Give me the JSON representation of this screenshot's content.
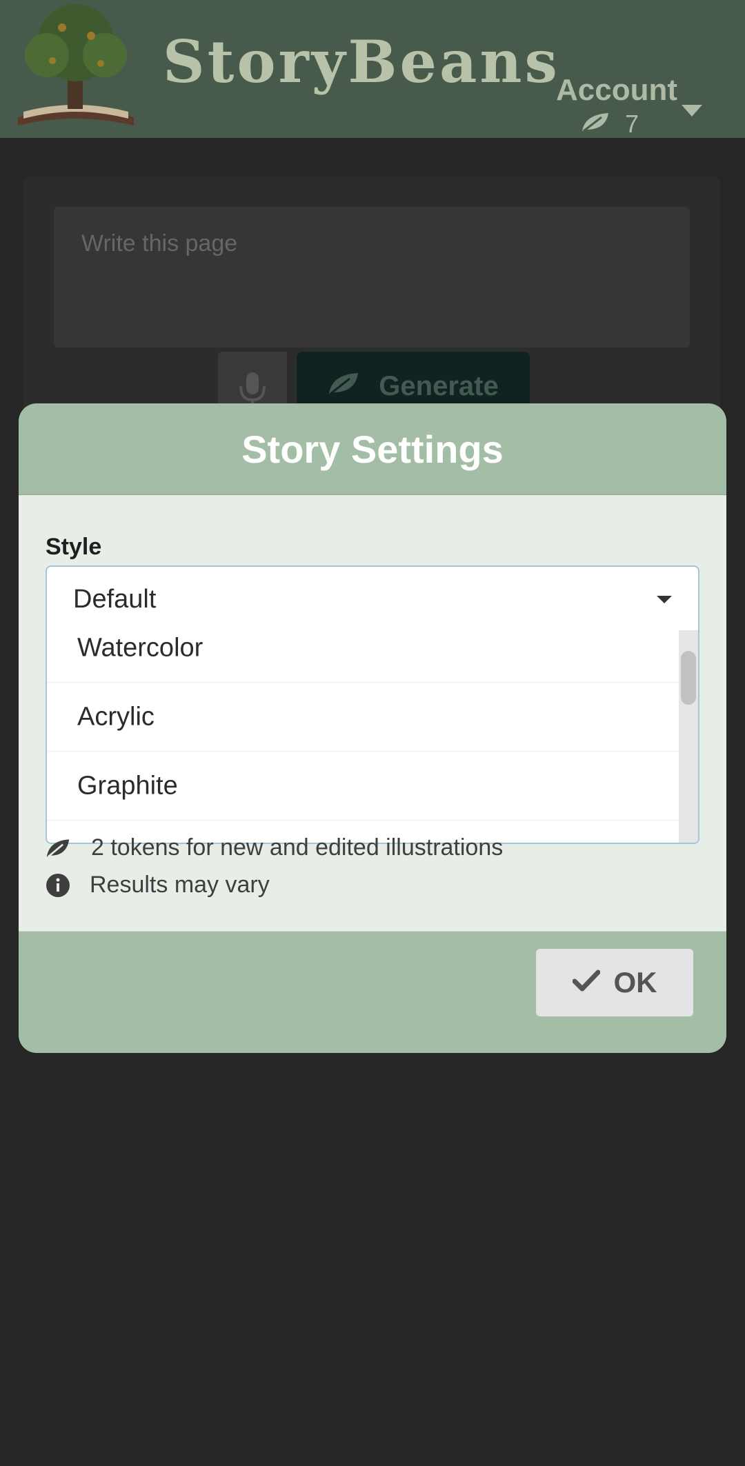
{
  "header": {
    "brand": "StoryBeans",
    "account_label": "Account",
    "token_count": "7"
  },
  "editor": {
    "placeholder": "Write this page",
    "generate_label": "Generate"
  },
  "modal": {
    "title": "Story Settings",
    "style_label": "Style",
    "selected_style": "Default",
    "options": [
      "Watercolor",
      "Acrylic",
      "Graphite"
    ],
    "info": [
      {
        "icon": "leaf-icon",
        "text": "2 tokens for new and edited illustrations"
      },
      {
        "icon": "info-circle-icon",
        "text": "Results may vary"
      }
    ],
    "ok_label": "OK"
  },
  "colors": {
    "modal_header": "#a3bda6",
    "modal_body": "#e7eee8",
    "overlay_bg": "#262626"
  }
}
